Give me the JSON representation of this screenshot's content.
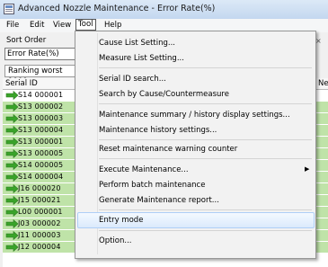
{
  "window": {
    "title": "Advanced Nozzle Maintenance - Error Rate(%)"
  },
  "menubar": {
    "file": "File",
    "edit": "Edit",
    "view": "View",
    "tool": "Tool",
    "help": "Help"
  },
  "filters": {
    "sort_order_label": "Sort Order",
    "sort_order_value": "Error Rate(%)",
    "ranking_value": "Ranking worst 1000"
  },
  "grid": {
    "col_serial": "Serial ID",
    "col_next": "Ne",
    "rows": [
      {
        "serial": "S14 000001",
        "selected": true
      },
      {
        "serial": "S13 000002"
      },
      {
        "serial": "S13 000003"
      },
      {
        "serial": "S13 000004"
      },
      {
        "serial": "S13 000001"
      },
      {
        "serial": "S13 000005"
      },
      {
        "serial": "S14 000005"
      },
      {
        "serial": "S14 000004"
      },
      {
        "serial": "J16 000020"
      },
      {
        "serial": "J15 000021"
      },
      {
        "serial": "L00 000001"
      },
      {
        "serial": "J03 000002"
      },
      {
        "serial": "J11 000003"
      },
      {
        "serial": "J12 000004",
        "value": "1·-10·"
      }
    ]
  },
  "tool_menu": {
    "cause_list": "Cause List Setting...",
    "measure_list": "Measure List Setting...",
    "serial_search": "Serial ID search...",
    "search_cause": "Search by Cause/Countermeasure",
    "summary_settings": "Maintenance summary / history display settings...",
    "history_settings": "Maintenance history settings...",
    "reset_warning": "Reset maintenance warning counter",
    "execute": "Execute Maintenance...",
    "batch": "Perform batch maintenance",
    "report": "Generate Maintenance report...",
    "entry_mode": "Entry mode",
    "option": "Option..."
  },
  "colors": {
    "row_green": "#bfe3a8",
    "menu_highlight": "#dbeafc",
    "arrow_green": "#3aa32a"
  }
}
